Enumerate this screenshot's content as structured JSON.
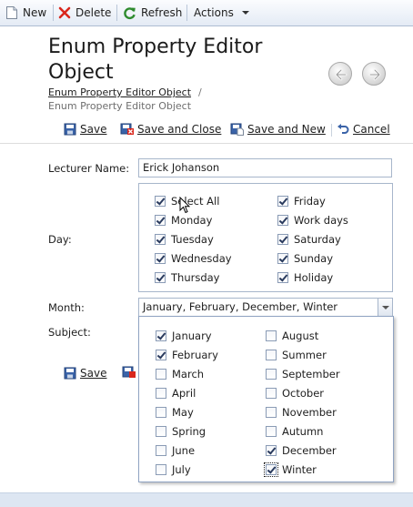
{
  "toolbar": {
    "new_label": "New",
    "delete_label": "Delete",
    "refresh_label": "Refresh",
    "actions_label": "Actions"
  },
  "page": {
    "title": "Enum Property Editor Object",
    "breadcrumb_link": "Enum Property Editor Object",
    "breadcrumb_separator": "/",
    "breadcrumb_current": "Enum Property Editor Object"
  },
  "actions": {
    "save": "Save",
    "save_and_close": "Save and Close",
    "save_and_new": "Save and New",
    "cancel": "Cancel"
  },
  "form": {
    "lecturer_label": "Lecturer Name:",
    "lecturer_value": "Erick Johanson",
    "day_label": "Day:",
    "month_label": "Month:",
    "month_value": "January, February, December, Winter",
    "subject_label": "Subject:"
  },
  "day_options": [
    {
      "label": "Select All",
      "checked": true
    },
    {
      "label": "Monday",
      "checked": true
    },
    {
      "label": "Tuesday",
      "checked": true
    },
    {
      "label": "Wednesday",
      "checked": true
    },
    {
      "label": "Thursday",
      "checked": true
    },
    {
      "label": "Friday",
      "checked": true
    },
    {
      "label": "Work days",
      "checked": true
    },
    {
      "label": "Saturday",
      "checked": true
    },
    {
      "label": "Sunday",
      "checked": true
    },
    {
      "label": "Holiday",
      "checked": true
    }
  ],
  "month_options": [
    {
      "label": "January",
      "checked": true
    },
    {
      "label": "February",
      "checked": true
    },
    {
      "label": "March",
      "checked": false
    },
    {
      "label": "April",
      "checked": false
    },
    {
      "label": "May",
      "checked": false
    },
    {
      "label": "Spring",
      "checked": false
    },
    {
      "label": "June",
      "checked": false
    },
    {
      "label": "July",
      "checked": false
    },
    {
      "label": "August",
      "checked": false
    },
    {
      "label": "Summer",
      "checked": false
    },
    {
      "label": "September",
      "checked": false
    },
    {
      "label": "October",
      "checked": false
    },
    {
      "label": "November",
      "checked": false
    },
    {
      "label": "Autumn",
      "checked": false
    },
    {
      "label": "December",
      "checked": true
    },
    {
      "label": "Winter",
      "checked": true
    }
  ],
  "bottom_actions": {
    "save": "Save"
  },
  "colors": {
    "toolbar_bg": "#e4ebf5",
    "border": "#a7b6cb",
    "delete_red": "#d9261c",
    "refresh_green": "#2e8b2e",
    "save_blue": "#3a63a8"
  }
}
